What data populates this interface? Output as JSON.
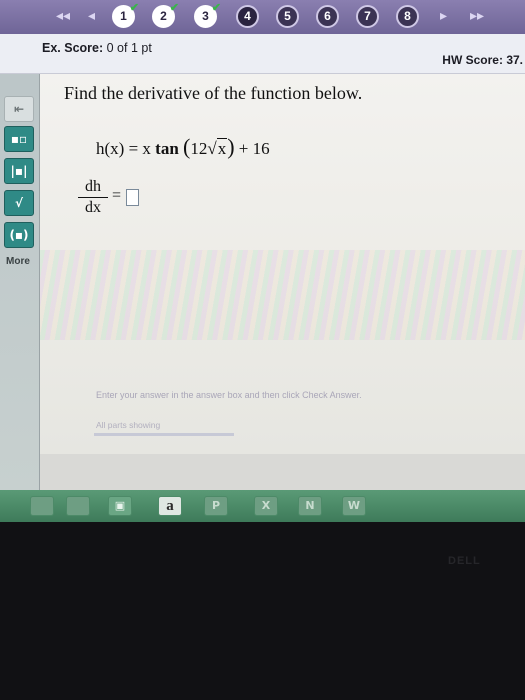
{
  "navigation": {
    "first_arrow": "◂◂",
    "prev_arrow": "◂",
    "next_arrow": "▸",
    "last_arrow": "▸▸",
    "questions": [
      {
        "label": "1",
        "status": "done"
      },
      {
        "label": "2",
        "status": "done"
      },
      {
        "label": "3",
        "status": "done"
      },
      {
        "label": "4",
        "status": "current"
      },
      {
        "label": "5",
        "status": "open"
      },
      {
        "label": "6",
        "status": "open"
      },
      {
        "label": "7",
        "status": "open"
      },
      {
        "label": "8",
        "status": "open"
      }
    ]
  },
  "score": {
    "ex_label": "Ex. Score:",
    "ex_value": "0 of 1 pt",
    "hw_label": "HW Score:",
    "hw_value": "37."
  },
  "tools": {
    "more_label": "More"
  },
  "question": {
    "prompt": "Find the derivative of the function below.",
    "function_lhs": "h(x) = x",
    "function_tan": "tan",
    "function_coef": "12",
    "function_radicand": "x",
    "function_rhs": "+ 16",
    "derivative_num": "dh",
    "derivative_den": "dx",
    "equals": "="
  },
  "footer": {
    "instruction": "Enter your answer in the answer box and then click Check Answer.",
    "parts_label": "All parts showing"
  },
  "taskbar": {
    "amazon_label": "a"
  },
  "bezel": {
    "brand": "DELL"
  },
  "colors": {
    "navbar": "#7b70a3",
    "tool_accent": "#2f8a86",
    "taskbar": "#4a8a66"
  }
}
